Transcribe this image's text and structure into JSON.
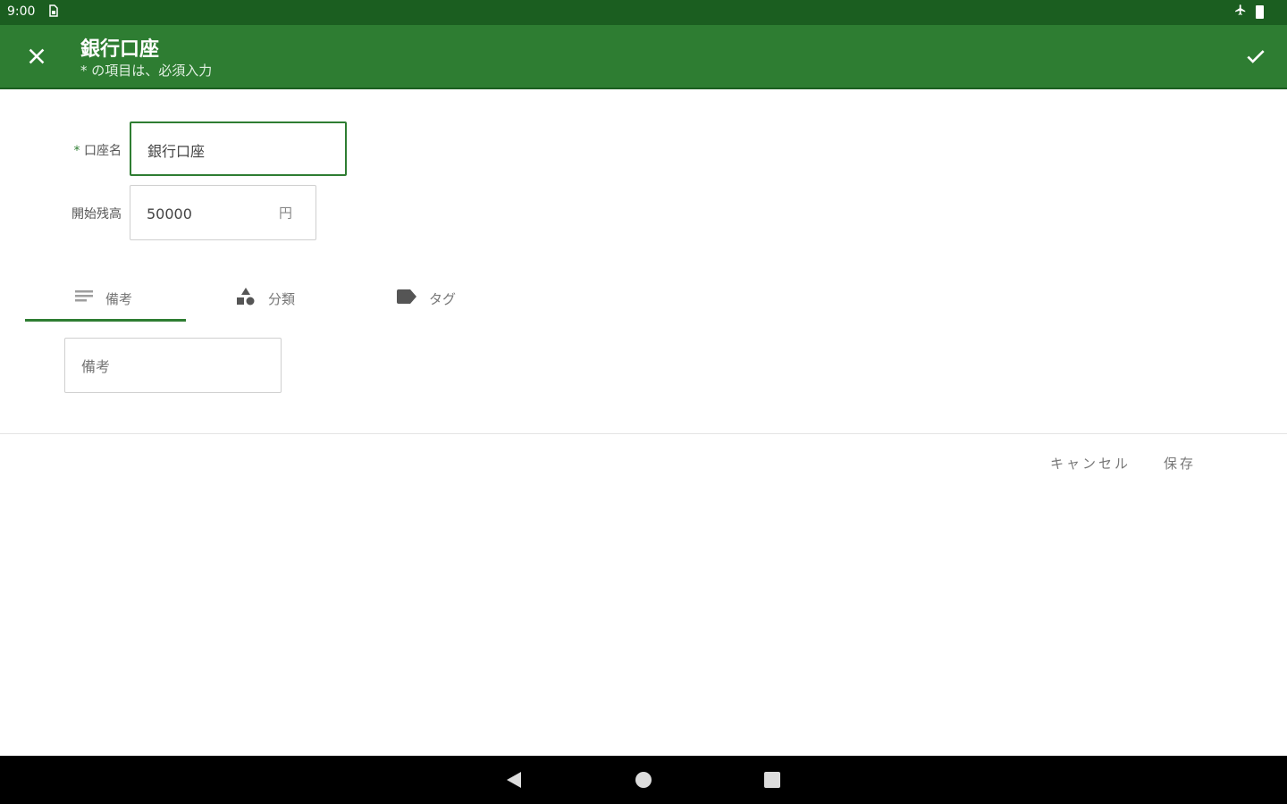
{
  "status_bar": {
    "time": "9:00",
    "sim_icon": "sim-card-icon",
    "airplane_icon": "airplane-icon",
    "battery_icon": "battery-icon"
  },
  "app_bar": {
    "title": "銀行口座",
    "subtitle": "* の項目は、必須入力",
    "close_icon": "close-icon",
    "confirm_icon": "check-icon",
    "color": "#2e7d32",
    "status_color": "#1b5e20"
  },
  "form": {
    "account_name": {
      "required_mark": "*",
      "label": "口座名",
      "value": "銀行口座"
    },
    "opening_balance": {
      "label": "開始残高",
      "value": "50000",
      "unit": "円"
    }
  },
  "tabs": [
    {
      "label": "備考",
      "icon": "notes-icon",
      "selected": true
    },
    {
      "label": "分類",
      "icon": "category-shapes-icon",
      "selected": false
    },
    {
      "label": "タグ",
      "icon": "tag-icon",
      "selected": false
    }
  ],
  "memo": {
    "placeholder": "備考"
  },
  "actions": {
    "cancel": "キャンセル",
    "save": "保存"
  },
  "nav_bar": {
    "back_icon": "back-triangle-icon",
    "home_icon": "home-circle-icon",
    "recents_icon": "recents-square-icon"
  }
}
